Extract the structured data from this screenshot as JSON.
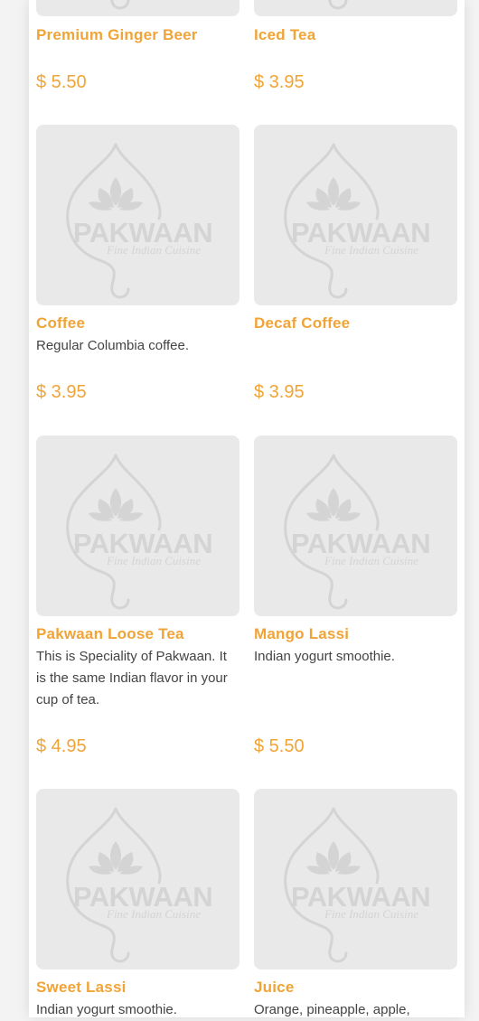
{
  "logo": {
    "brand": "PAKWAAN",
    "tagline": "Fine Indian Cuisine"
  },
  "items": [
    {
      "name": "Premium Ginger Beer",
      "description": "",
      "price": "$ 5.50"
    },
    {
      "name": "Iced Tea",
      "description": "",
      "price": "$ 3.95"
    },
    {
      "name": "Coffee",
      "description": "Regular Columbia coffee.",
      "price": "$ 3.95"
    },
    {
      "name": "Decaf Coffee",
      "description": "",
      "price": "$ 3.95"
    },
    {
      "name": "Pakwaan Loose Tea",
      "description": "This is Speciality of Pakwaan. It is the same Indian flavor in your cup of tea.",
      "price": "$ 4.95"
    },
    {
      "name": "Mango Lassi",
      "description": "Indian yogurt smoothie.",
      "price": "$ 5.50"
    },
    {
      "name": "Sweet Lassi",
      "description": "Indian yogurt smoothie.",
      "price": ""
    },
    {
      "name": "Juice",
      "description": "Orange, pineapple, apple,",
      "price": ""
    }
  ]
}
